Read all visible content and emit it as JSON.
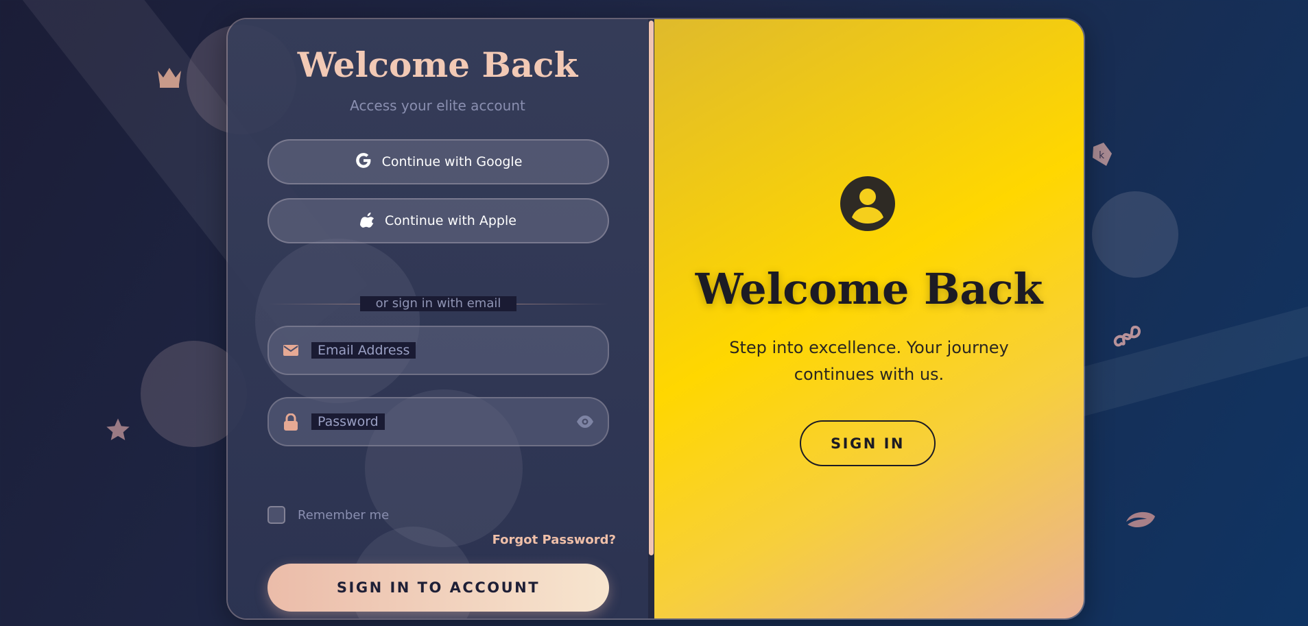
{
  "colors": {
    "accent": "#f2c9b5",
    "panel_yellow": "#ffd700",
    "background_dark": "#1b1d37",
    "background_blue": "#0f3463"
  },
  "login": {
    "title": "Welcome Back",
    "subtitle": "Access your elite account",
    "google_label": "Continue with Google",
    "apple_label": "Continue with Apple",
    "divider_text": "or sign in with email",
    "email_placeholder": "Email Address",
    "password_placeholder": "Password",
    "remember_label": "Remember me",
    "forgot_label": "Forgot Password?",
    "submit_label": "SIGN IN TO ACCOUNT",
    "icons": {
      "google": "google-icon",
      "apple": "apple-icon",
      "email": "envelope-icon",
      "password": "lock-icon",
      "toggle": "eye-icon"
    }
  },
  "overlay": {
    "title": "Welcome Back",
    "tagline": "Step into excellence. Your journey continues with us.",
    "button_label": "SIGN IN",
    "icon": "user-circle-icon"
  },
  "decorations": [
    "crown-icon",
    "star-icon",
    "kanji-gem-icon",
    "infinity-icon",
    "leaf-icon"
  ]
}
